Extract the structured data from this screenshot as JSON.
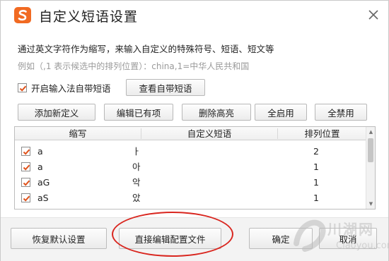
{
  "window": {
    "title": "自定义短语设置",
    "brand_color": "#f16a22"
  },
  "description": "通过英文字符作为缩写，来输入自定义的特殊符号、短语、短文等",
  "example": "例如（,1 表示候选中的排列位置）：china,1=中华人民共和国",
  "builtin_checkbox": {
    "label": "开启输入法自带短语",
    "checked": true,
    "view_button": "查看自带短语"
  },
  "toolbar": {
    "add": "添加新定义",
    "edit": "编辑已有项",
    "delete": "删除高亮",
    "enable_all": "全启用",
    "disable_all": "全禁用"
  },
  "table": {
    "columns": [
      "缩写",
      "自定义短语",
      "排列位置"
    ],
    "rows": [
      {
        "checked": true,
        "abbr": "a",
        "phrase": "ㅏ",
        "position": "2"
      },
      {
        "checked": true,
        "abbr": "a",
        "phrase": "아",
        "position": "1"
      },
      {
        "checked": true,
        "abbr": "aG",
        "phrase": "악",
        "position": "1"
      },
      {
        "checked": true,
        "abbr": "aS",
        "phrase": "았",
        "position": "1"
      }
    ]
  },
  "footer": {
    "restore": "恢复默认设置",
    "edit_config": "直接编辑配置文件",
    "ok": "确定",
    "cancel": "取消"
  },
  "highlight_color": "#d9261f",
  "watermark": {
    "line1": "川湖网",
    "line2": "Ciaoyou.com"
  }
}
